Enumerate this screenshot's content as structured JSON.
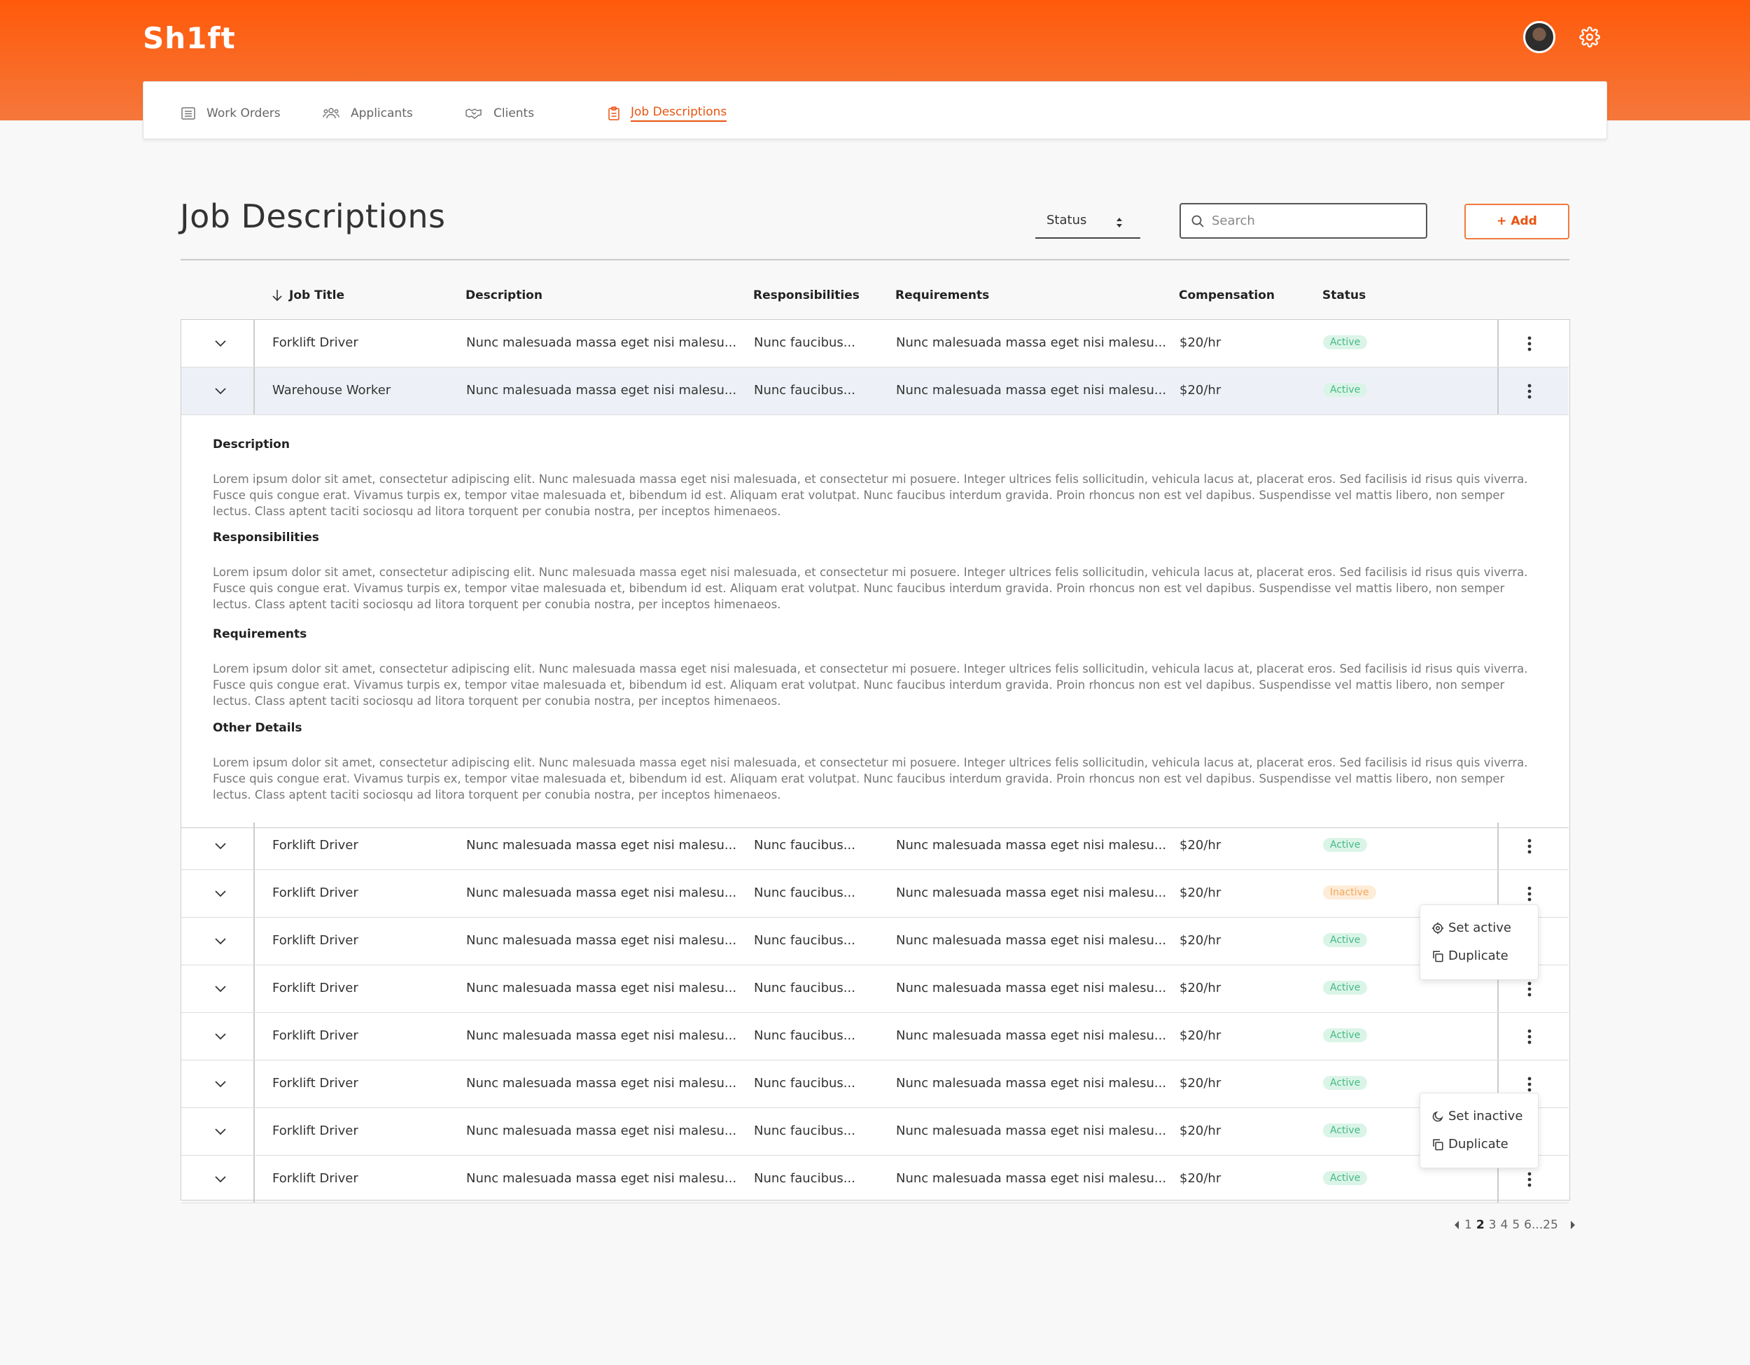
{
  "app": {
    "logo": "Sh1ft"
  },
  "nav": [
    {
      "label": "Work Orders",
      "icon": "list-icon",
      "active": false
    },
    {
      "label": "Applicants",
      "icon": "users-icon",
      "active": false
    },
    {
      "label": "Clients",
      "icon": "handshake-icon",
      "active": false
    },
    {
      "label": "Job Descriptions",
      "icon": "clipboard-icon",
      "active": true
    }
  ],
  "page": {
    "title": "Job Descriptions",
    "status_filter": "Status",
    "search_placeholder": "Search",
    "add_label": "+ Add"
  },
  "table": {
    "columns": [
      "Job Title",
      "Description",
      "Responsibilities",
      "Requirements",
      "Compensation",
      "Status"
    ],
    "rows": [
      {
        "title": "Forklift Driver",
        "description": "Nunc malesuada massa eget nisi malesu...",
        "responsibilities": "Nunc faucibus...",
        "requirements": "Nunc malesuada massa eget nisi malesu...",
        "compensation": "$20/hr",
        "status": "Active"
      },
      {
        "title": "Warehouse Worker",
        "description": "Nunc malesuada massa eget nisi malesu...",
        "responsibilities": "Nunc faucibus...",
        "requirements": "Nunc malesuada massa eget nisi malesu...",
        "compensation": "$20/hr",
        "status": "Active"
      },
      {
        "title": "Forklift Driver",
        "description": "Nunc malesuada massa eget nisi malesu...",
        "responsibilities": "Nunc faucibus...",
        "requirements": "Nunc malesuada massa eget nisi malesu...",
        "compensation": "$20/hr",
        "status": "Active"
      },
      {
        "title": "Forklift Driver",
        "description": "Nunc malesuada massa eget nisi malesu...",
        "responsibilities": "Nunc faucibus...",
        "requirements": "Nunc malesuada massa eget nisi malesu...",
        "compensation": "$20/hr",
        "status": "Inactive"
      },
      {
        "title": "Forklift Driver",
        "description": "Nunc malesuada massa eget nisi malesu...",
        "responsibilities": "Nunc faucibus...",
        "requirements": "Nunc malesuada massa eget nisi malesu...",
        "compensation": "$20/hr",
        "status": "Active"
      },
      {
        "title": "Forklift Driver",
        "description": "Nunc malesuada massa eget nisi malesu...",
        "responsibilities": "Nunc faucibus...",
        "requirements": "Nunc malesuada massa eget nisi malesu...",
        "compensation": "$20/hr",
        "status": "Active"
      },
      {
        "title": "Forklift Driver",
        "description": "Nunc malesuada massa eget nisi malesu...",
        "responsibilities": "Nunc faucibus...",
        "requirements": "Nunc malesuada massa eget nisi malesu...",
        "compensation": "$20/hr",
        "status": "Active"
      },
      {
        "title": "Forklift Driver",
        "description": "Nunc malesuada massa eget nisi malesu...",
        "responsibilities": "Nunc faucibus...",
        "requirements": "Nunc malesuada massa eget nisi malesu...",
        "compensation": "$20/hr",
        "status": "Active"
      },
      {
        "title": "Forklift Driver",
        "description": "Nunc malesuada massa eget nisi malesu...",
        "responsibilities": "Nunc faucibus...",
        "requirements": "Nunc malesuada massa eget nisi malesu...",
        "compensation": "$20/hr",
        "status": "Active"
      },
      {
        "title": "Forklift Driver",
        "description": "Nunc malesuada massa eget nisi malesu...",
        "responsibilities": "Nunc faucibus...",
        "requirements": "Nunc malesuada massa eget nisi malesu...",
        "compensation": "$20/hr",
        "status": "Active"
      }
    ]
  },
  "detail": {
    "sections": [
      {
        "heading": "Description",
        "text": "Lorem ipsum dolor sit amet, consectetur adipiscing elit. Nunc malesuada massa eget nisi malesuada, et consectetur mi posuere. Integer ultrices felis sollicitudin, vehicula lacus at, placerat eros. Sed facilisis id risus quis viverra. Fusce quis congue erat. Vivamus turpis ex, tempor vitae malesuada et, bibendum id est. Aliquam erat volutpat. Nunc faucibus interdum gravida. Proin rhoncus non est vel dapibus. Suspendisse vel mattis libero, non semper lectus. Class aptent taciti sociosqu ad litora torquent per conubia nostra, per inceptos himenaeos."
      },
      {
        "heading": "Responsibilities",
        "text": "Lorem ipsum dolor sit amet, consectetur adipiscing elit. Nunc malesuada massa eget nisi malesuada, et consectetur mi posuere. Integer ultrices felis sollicitudin, vehicula lacus at, placerat eros. Sed facilisis id risus quis viverra. Fusce quis congue erat. Vivamus turpis ex, tempor vitae malesuada et, bibendum id est. Aliquam erat volutpat. Nunc faucibus interdum gravida. Proin rhoncus non est vel dapibus. Suspendisse vel mattis libero, non semper lectus. Class aptent taciti sociosqu ad litora torquent per conubia nostra, per inceptos himenaeos."
      },
      {
        "heading": "Requirements",
        "text": "Lorem ipsum dolor sit amet, consectetur adipiscing elit. Nunc malesuada massa eget nisi malesuada, et consectetur mi posuere. Integer ultrices felis sollicitudin, vehicula lacus at, placerat eros. Sed facilisis id risus quis viverra. Fusce quis congue erat. Vivamus turpis ex, tempor vitae malesuada et, bibendum id est. Aliquam erat volutpat. Nunc faucibus interdum gravida. Proin rhoncus non est vel dapibus. Suspendisse vel mattis libero, non semper lectus. Class aptent taciti sociosqu ad litora torquent per conubia nostra, per inceptos himenaeos."
      },
      {
        "heading": "Other Details",
        "text": "Lorem ipsum dolor sit amet, consectetur adipiscing elit. Nunc malesuada massa eget nisi malesuada, et consectetur mi posuere. Integer ultrices felis sollicitudin, vehicula lacus at, placerat eros. Sed facilisis id risus quis viverra. Fusce quis congue erat. Vivamus turpis ex, tempor vitae malesuada et, bibendum id est. Aliquam erat volutpat. Nunc faucibus interdum gravida. Proin rhoncus non est vel dapibus. Suspendisse vel mattis libero, non semper lectus. Class aptent taciti sociosqu ad litora torquent per conubia nostra, per inceptos himenaeos."
      }
    ]
  },
  "menus": [
    {
      "items": [
        {
          "label": "Set active",
          "icon": "gear-icon"
        },
        {
          "label": "Duplicate",
          "icon": "copy-icon"
        }
      ]
    },
    {
      "items": [
        {
          "label": "Set inactive",
          "icon": "moon-icon"
        },
        {
          "label": "Duplicate",
          "icon": "copy-icon"
        }
      ]
    }
  ],
  "pagination": {
    "pages": [
      "1",
      "2",
      "3",
      "4",
      "5",
      "6...25"
    ],
    "current": "2"
  },
  "colors": {
    "brand": "#ff5a0a",
    "accent": "#e8540f",
    "active_badge_bg": "#dbf4e8",
    "active_badge_text": "#46b983",
    "inactive_badge_bg": "#fdecd8",
    "inactive_badge_text": "#f3a85d",
    "selected_row": "#edf1f7"
  }
}
